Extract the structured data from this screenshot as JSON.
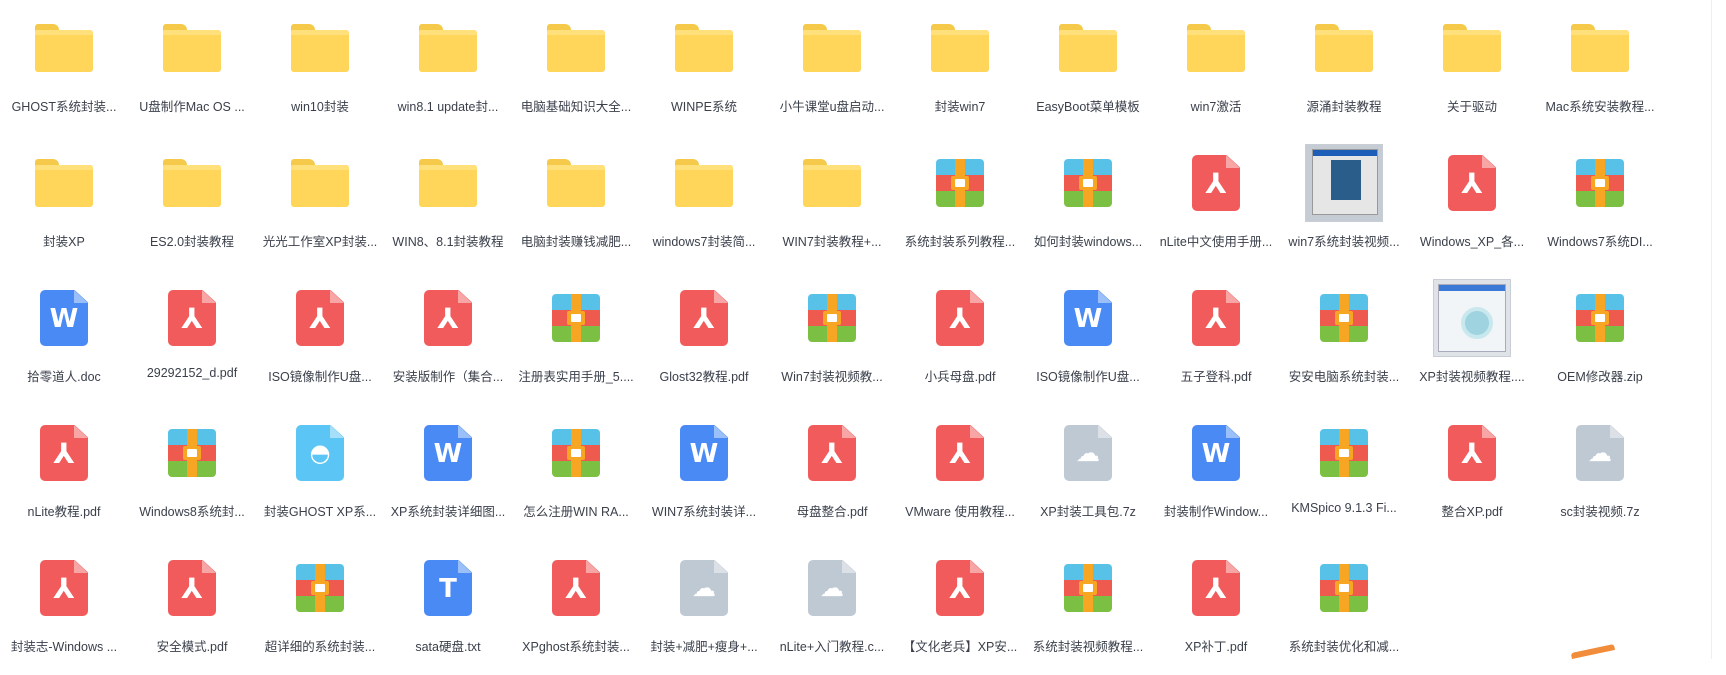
{
  "rows": [
    [
      {
        "name": "GHOST系统封装...",
        "type": "folder"
      },
      {
        "name": "U盘制作Mac OS ...",
        "type": "folder"
      },
      {
        "name": "win10封装",
        "type": "folder"
      },
      {
        "name": "win8.1 update封...",
        "type": "folder"
      },
      {
        "name": "电脑基础知识大全...",
        "type": "folder"
      },
      {
        "name": "WINPE系统",
        "type": "folder"
      },
      {
        "name": "小牛课堂u盘启动...",
        "type": "folder"
      },
      {
        "name": "封装win7",
        "type": "folder"
      },
      {
        "name": "EasyBoot菜单模板",
        "type": "folder"
      },
      {
        "name": "win7激活",
        "type": "folder"
      },
      {
        "name": "源涌封装教程",
        "type": "folder"
      },
      {
        "name": "关于驱动",
        "type": "folder"
      },
      {
        "name": "Mac系统安装教程...",
        "type": "folder"
      }
    ],
    [
      {
        "name": "封装XP",
        "type": "folder"
      },
      {
        "name": "ES2.0封装教程",
        "type": "folder"
      },
      {
        "name": "光光工作室XP封装...",
        "type": "folder"
      },
      {
        "name": "WIN8、8.1封装教程",
        "type": "folder"
      },
      {
        "name": "电脑封装赚钱减肥...",
        "type": "folder"
      },
      {
        "name": "windows7封装简...",
        "type": "folder"
      },
      {
        "name": "WIN7封装教程+...",
        "type": "folder"
      },
      {
        "name": "系统封装系列教程...",
        "type": "zip"
      },
      {
        "name": "如何封装windows...",
        "type": "zip"
      },
      {
        "name": "nLite中文使用手册...",
        "type": "pdf"
      },
      {
        "name": "win7系统封装视频...",
        "type": "thumb1"
      },
      {
        "name": "Windows_XP_各...",
        "type": "pdf"
      },
      {
        "name": "Windows7系统DI...",
        "type": "zip"
      }
    ],
    [
      {
        "name": "拾零道人.doc",
        "type": "word"
      },
      {
        "name": "29292152_d.pdf",
        "type": "pdf"
      },
      {
        "name": "ISO镜像制作U盘...",
        "type": "pdf"
      },
      {
        "name": "安装版制作（集合...",
        "type": "pdf"
      },
      {
        "name": "注册表实用手册_5....",
        "type": "zip"
      },
      {
        "name": "Glost32教程.pdf",
        "type": "pdf"
      },
      {
        "name": "Win7封装视频教...",
        "type": "zip"
      },
      {
        "name": "小兵母盘.pdf",
        "type": "pdf"
      },
      {
        "name": "ISO镜像制作U盘...",
        "type": "word"
      },
      {
        "name": "五子登科.pdf",
        "type": "pdf"
      },
      {
        "name": "安安电脑系统封装...",
        "type": "zip"
      },
      {
        "name": "XP封装视频教程....",
        "type": "thumb2"
      },
      {
        "name": "OEM修改器.zip",
        "type": "zip"
      }
    ],
    [
      {
        "name": "nLite教程.pdf",
        "type": "pdf"
      },
      {
        "name": "Windows8系统封...",
        "type": "zip"
      },
      {
        "name": "封装GHOST XP系...",
        "type": "exe"
      },
      {
        "name": "XP系统封装详细图...",
        "type": "word"
      },
      {
        "name": "怎么注册WIN RA...",
        "type": "zip"
      },
      {
        "name": "WIN7系统封装详...",
        "type": "word"
      },
      {
        "name": "母盘整合.pdf",
        "type": "pdf"
      },
      {
        "name": "VMware 使用教程...",
        "type": "pdf"
      },
      {
        "name": "XP封装工具包.7z",
        "type": "cloud"
      },
      {
        "name": "封装制作Window...",
        "type": "word"
      },
      {
        "name": "KMSpico 9.1.3 Fi...",
        "type": "zip"
      },
      {
        "name": "整合XP.pdf",
        "type": "pdf"
      },
      {
        "name": "sc封装视频.7z",
        "type": "cloud"
      }
    ],
    [
      {
        "name": "封装志-Windows ...",
        "type": "pdf"
      },
      {
        "name": "安全模式.pdf",
        "type": "pdf"
      },
      {
        "name": "超详细的系统封装...",
        "type": "zip"
      },
      {
        "name": "sata硬盘.txt",
        "type": "txt"
      },
      {
        "name": "XPghost系统封装...",
        "type": "pdf"
      },
      {
        "name": "封装+减肥+瘦身+...",
        "type": "cloud"
      },
      {
        "name": "nLite+入门教程.c...",
        "type": "cloud"
      },
      {
        "name": "【文化老兵】XP安...",
        "type": "pdf"
      },
      {
        "name": "系统封装视频教程...",
        "type": "zip"
      },
      {
        "name": "XP补丁.pdf",
        "type": "pdf"
      },
      {
        "name": "系统封装优化和减...",
        "type": "zip"
      }
    ]
  ],
  "colors": {
    "folder": "#ffd659",
    "pdf": "#f15b5b",
    "word": "#4a8af4",
    "cloud": "#bfc9d4",
    "exe": "#5bc5f5"
  },
  "glyphs": {
    "word": "W",
    "txt": "T",
    "pdf": "⅄",
    "cloud": "☁",
    "exe": "◓"
  }
}
